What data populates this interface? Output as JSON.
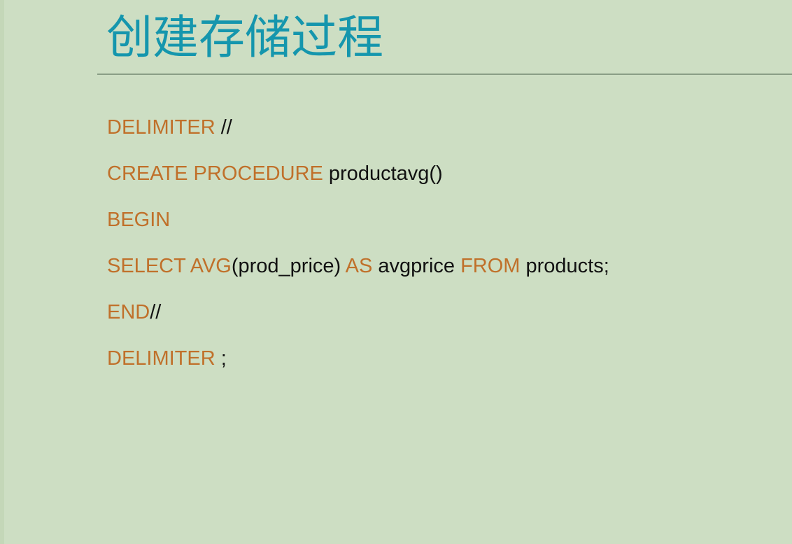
{
  "slide": {
    "title": "创建存储过程"
  },
  "code": {
    "lines": [
      [
        {
          "kind": "kw",
          "text": "DELIMITER"
        },
        {
          "kind": "tx",
          "text": " //"
        }
      ],
      [
        {
          "kind": "kw",
          "text": "CREATE PROCEDURE"
        },
        {
          "kind": "tx",
          "text": " productavg()"
        }
      ],
      [
        {
          "kind": "kw",
          "text": "BEGIN"
        }
      ],
      [
        {
          "kind": "kw",
          "text": "SELECT AVG"
        },
        {
          "kind": "tx",
          "text": "(prod_price) "
        },
        {
          "kind": "kw",
          "text": "AS"
        },
        {
          "kind": "tx",
          "text": " avgprice "
        },
        {
          "kind": "kw",
          "text": "FROM"
        },
        {
          "kind": "tx",
          "text": " products;"
        }
      ],
      [
        {
          "kind": "kw",
          "text": "END"
        },
        {
          "kind": "tx",
          "text": "//"
        }
      ],
      [
        {
          "kind": "kw",
          "text": "DELIMITER"
        },
        {
          "kind": "tx",
          "text": " ;"
        }
      ]
    ]
  },
  "colors": {
    "background": "#cddec3",
    "title": "#1596ad",
    "keyword": "#c0702a",
    "text": "#111111",
    "rule": "#8a9e86"
  }
}
